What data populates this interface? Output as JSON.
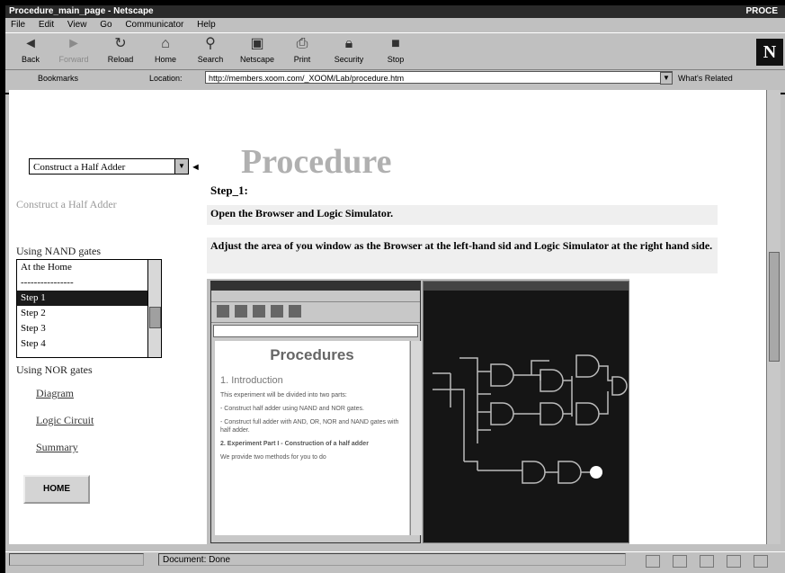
{
  "window": {
    "title": "Procedure_main_page - Netscape",
    "title_right": "PROCE"
  },
  "menu": [
    "File",
    "Edit",
    "View",
    "Go",
    "Communicator",
    "Help"
  ],
  "toolbar": {
    "buttons": [
      {
        "label": "Back",
        "icon": "back-arrow-icon",
        "enabled": true
      },
      {
        "label": "Forward",
        "icon": "forward-arrow-icon",
        "enabled": false
      },
      {
        "label": "Reload",
        "icon": "reload-icon",
        "enabled": true
      },
      {
        "label": "Home",
        "icon": "home-icon",
        "enabled": true
      },
      {
        "label": "Search",
        "icon": "search-icon",
        "enabled": true
      },
      {
        "label": "Netscape",
        "icon": "netscape-icon",
        "enabled": true
      },
      {
        "label": "Print",
        "icon": "print-icon",
        "enabled": true
      },
      {
        "label": "Security",
        "icon": "security-icon",
        "enabled": true
      },
      {
        "label": "Stop",
        "icon": "stop-icon",
        "enabled": true
      }
    ],
    "logo": "N"
  },
  "location": {
    "bookmarks_label": "Bookmarks",
    "location_label": "Location:",
    "url": "http://members.xoom.com/_XOOM/Lab/procedure.htm",
    "related_label": "What's Related"
  },
  "left": {
    "select_value": "Construct a Half Adder",
    "title": "Construct a Half Adder",
    "nand_heading": "Using NAND gates",
    "list_items": [
      "At the Home",
      "----------------",
      "Step 1",
      "Step 2",
      "Step 3",
      "Step 4"
    ],
    "selected_index": 2,
    "nor_heading": "Using NOR gates",
    "links": [
      "Diagram",
      "Logic Circuit",
      "Summary"
    ],
    "home_button": "HOME"
  },
  "main": {
    "title": "Procedure",
    "step": "Step_1:",
    "instruction1": "Open the Browser and Logic Simulator.",
    "instruction2": "Adjust the area of you window as the Browser at the left-hand sid and Logic Simulator at the right hand side.",
    "embedded": {
      "heading": "Procedures",
      "section1": "1. Introduction",
      "p1": "This experiment will be divided into two parts:",
      "p2": "- Construct half adder using NAND and NOR gates.",
      "p3": "- Construct full adder with AND, OR, NOR and NAND gates with half adder.",
      "section2": "2. Experiment Part I - Construction of a half adder",
      "p4": "We provide two methods for you to do"
    }
  },
  "status": {
    "text": "Document: Done"
  },
  "colors": {
    "title_gray": "#b0b0b0",
    "link_gray": "#9a9a9a"
  }
}
